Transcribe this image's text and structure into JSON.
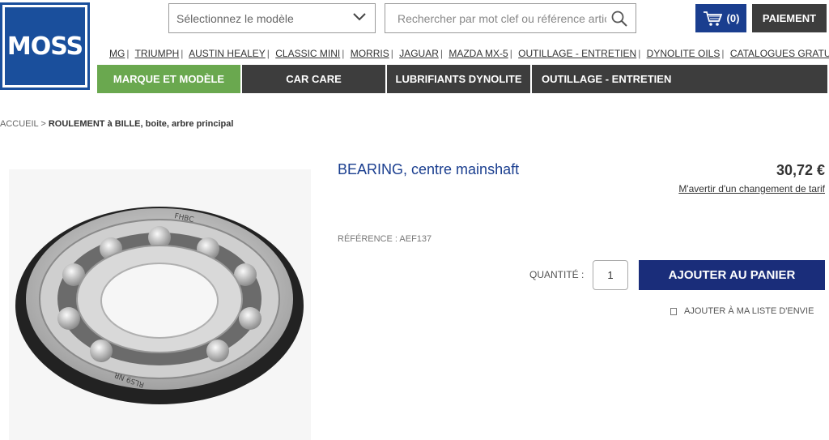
{
  "header": {
    "logo_text": "MOSS",
    "model_select": {
      "placeholder": "Sélectionnez le modèle"
    },
    "search": {
      "placeholder": "Rechercher par mot clef ou référence article"
    },
    "cart": {
      "count_label": "(0)"
    },
    "checkout_label": "PAIEMENT"
  },
  "brand_links": [
    "MG",
    "TRIUMPH",
    "AUSTIN HEALEY",
    "CLASSIC MINI",
    "MORRIS",
    "JAGUAR",
    "MAZDA MX-5",
    "OUTILLAGE - ENTRETIEN",
    "DYNOLITE OILS",
    "CATALOGUES GRATUITS"
  ],
  "menu": [
    {
      "label": "MARQUE ET MODÈLE",
      "active": true
    },
    {
      "label": "CAR CARE",
      "active": false
    },
    {
      "label": "LUBRIFIANTS DYNOLITE",
      "active": false
    },
    {
      "label": "OUTILLAGE - ENTRETIEN",
      "active": false
    }
  ],
  "breadcrumb": {
    "home": "ACCUEIL",
    "separator": ">",
    "current": "ROULEMENT à BILLE, boite, arbre principal"
  },
  "product": {
    "title": "BEARING, centre mainshaft",
    "price": "30,72 €",
    "notify_link": "M'avertir d'un changement de tarif",
    "reference": "RÉFÉRENCE : AEF137",
    "quantity_label": "QUANTITÉ :",
    "quantity_value": "1",
    "add_to_cart_label": "AJOUTER AU PANIER",
    "wishlist_label": "AJOUTER À MA LISTE D'ENVIE",
    "image_markings": [
      "FHBC",
      "RLS9 NR"
    ]
  },
  "colors": {
    "brand_blue": "#1a4f9c",
    "title_blue": "#1a3e8f",
    "cart_button": "#1a2d7a",
    "menu_dark": "#3d3d3d",
    "menu_active": "#6aa84f"
  }
}
